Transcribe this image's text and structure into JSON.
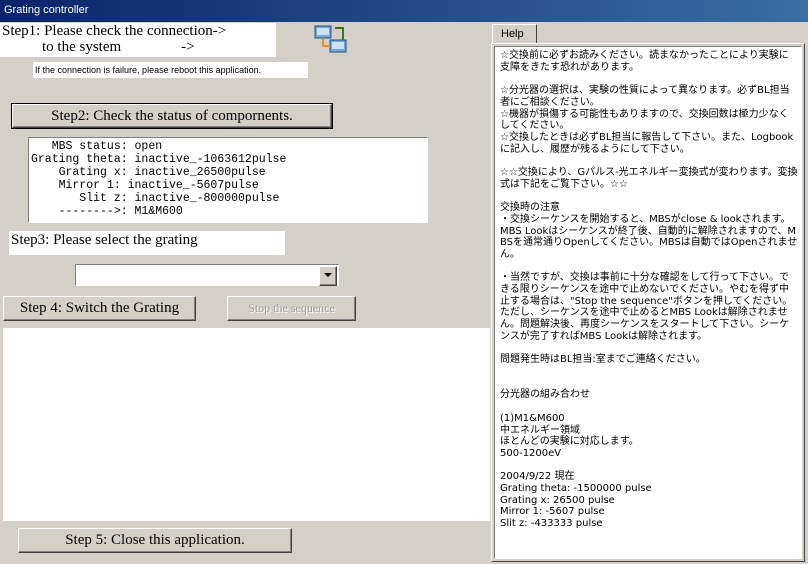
{
  "window": {
    "title": "Grating controller"
  },
  "step1": {
    "line1": "Step1: Please check the connection->",
    "line2": "to the system                ->",
    "note": "If the connection is failure, please reboot this application."
  },
  "step2": {
    "button_label": "Step2: Check the status of  compornents."
  },
  "status": {
    "lines": "   MBS status: open\nGrating theta: inactive_-1063612pulse\n    Grating x: inactive_26500pulse\n    Mirror 1: inactive_-5607pulse\n       Slit z: inactive_-800000pulse\n    -------->: M1&M600"
  },
  "step3": {
    "label": "Step3: Please select the grating",
    "selected_value": ""
  },
  "step4": {
    "button_label": "Step 4: Switch the Grating",
    "stop_label": "Stop the sequence"
  },
  "step5": {
    "button_label": "Step 5:  Close this application."
  },
  "help": {
    "tab_label": "Help",
    "text": "☆交換前に必ずお読みください。読まなかったことにより実験に支障をきたす恐れがあります。\n\n☆分光器の選択は、実験の性質によって異なります。必ずBL担当者にご相談ください。\n☆機器が損傷する可能性もありますので、交換回数は極力少なくしてください。\n☆交換したときは必ずBL担当に報告して下さい。また、Logbookに記入し、履歴が残るようにして下さい。\n\n☆☆交換により、Gパルス-光エネルギー変換式が変わります。変換式は下記をご覧下さい。☆☆\n\n交換時の注意\n・交換シーケンスを開始すると、MBSがclose & lookされます。MBS Lookはシーケンスが終了後、自動的に解除されますので、MBSを通常通りOpenしてください。MBSは自動ではOpenされません。\n\n・当然ですが、交換は事前に十分な確認をして行って下さい。できる限りシーケンスを途中で止めないでください。やむを得ず中止する場合は、\"Stop the sequence\"ボタンを押してください。ただし、シーケンスを途中で止めるとMBS Lookは解除されません。問題解決後、再度シーケンスをスタートして下さい。シーケンスが完了すればMBS Lookは解除されます。\n\n問題発生時はBL担当:室までご連絡ください。\n\n\n分光器の組み合わせ\n\n(1)M1&M600\n中エネルギー領域\nほとんどの実験に対応します。\n500-1200eV\n\n2004/9/22 現在\nGrating theta: -1500000 pulse\nGrating x: 26500 pulse\nMirror 1: -5607 pulse\nSlit z: -433333 pulse"
  },
  "icons": {
    "connection": "network-connection-icon"
  }
}
